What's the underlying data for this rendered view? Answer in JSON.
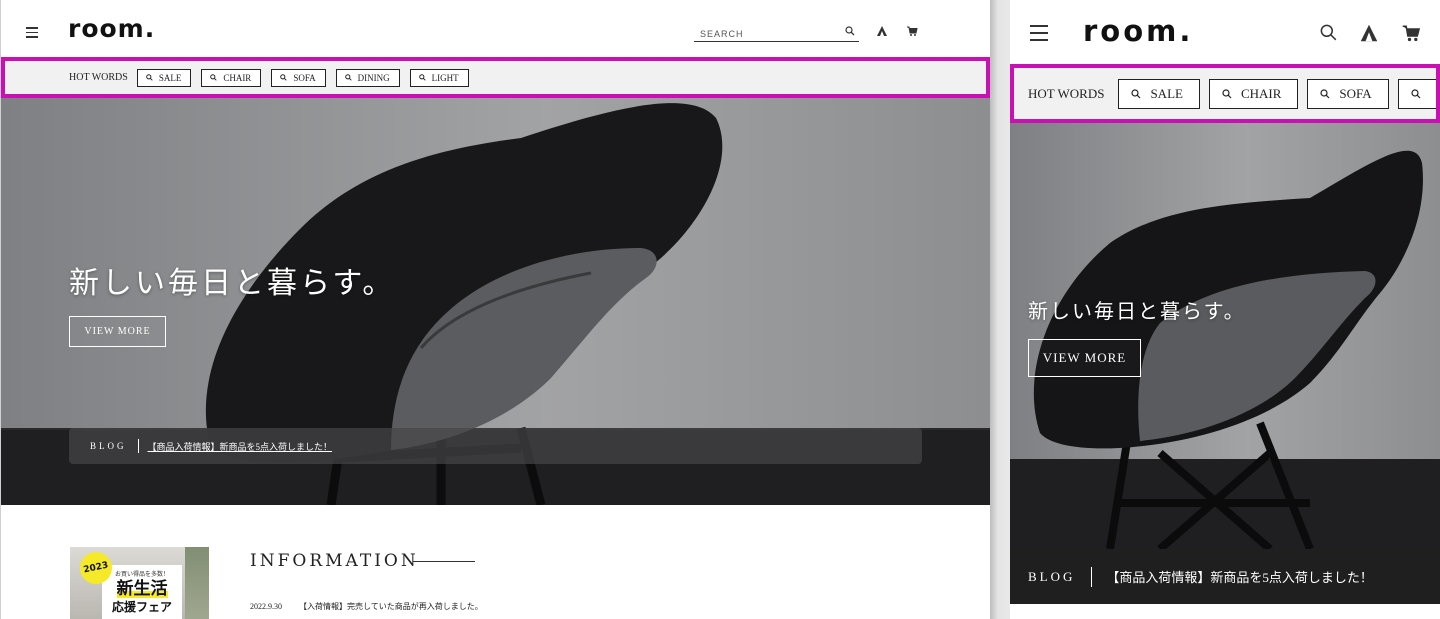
{
  "desktop": {
    "logo": "room.",
    "search": {
      "placeholder": "SEARCH"
    },
    "icons": {
      "menu": "hamburger-icon",
      "search": "search-icon",
      "tent": "tent-icon",
      "cart": "cart-icon"
    },
    "hot_words": {
      "label": "HOT WORDS",
      "items": [
        "SALE",
        "CHAIR",
        "SOFA",
        "DINING",
        "LIGHT"
      ]
    },
    "hero": {
      "catchphrase": "新しい毎日と暮らす。",
      "cta": "VIEW MORE"
    },
    "blog": {
      "tag": "BLOG",
      "headline": "【商品入荷情報】新商品を5点入荷しました！"
    },
    "information": {
      "title": "INFORMATION",
      "banner": {
        "badge": "2023",
        "small": "お買い得品を多数！",
        "big": "新生活",
        "mid": "応援フェア"
      },
      "items": [
        {
          "date": "2022.9.30",
          "text": "【入荷情報】完売していた商品が再入荷しました。"
        }
      ]
    }
  },
  "mobile": {
    "logo": "room.",
    "icons": {
      "menu": "hamburger-icon",
      "search": "search-icon",
      "tent": "tent-icon",
      "cart": "cart-icon"
    },
    "hot_words": {
      "label": "HOT WORDS",
      "items": [
        "SALE",
        "CHAIR",
        "SOFA",
        ""
      ]
    },
    "hero": {
      "catchphrase": "新しい毎日と暮らす。",
      "cta": "VIEW MORE"
    },
    "blog": {
      "tag": "BLOG",
      "headline": "【商品入荷情報】新商品を5点入荷しました！"
    }
  },
  "colors": {
    "highlight_frame": "#c810b3",
    "hotbar_bg": "#f1f1f1",
    "blog_bar_mobile": "#1f1f20",
    "banner_yellow": "#f6ea28"
  }
}
